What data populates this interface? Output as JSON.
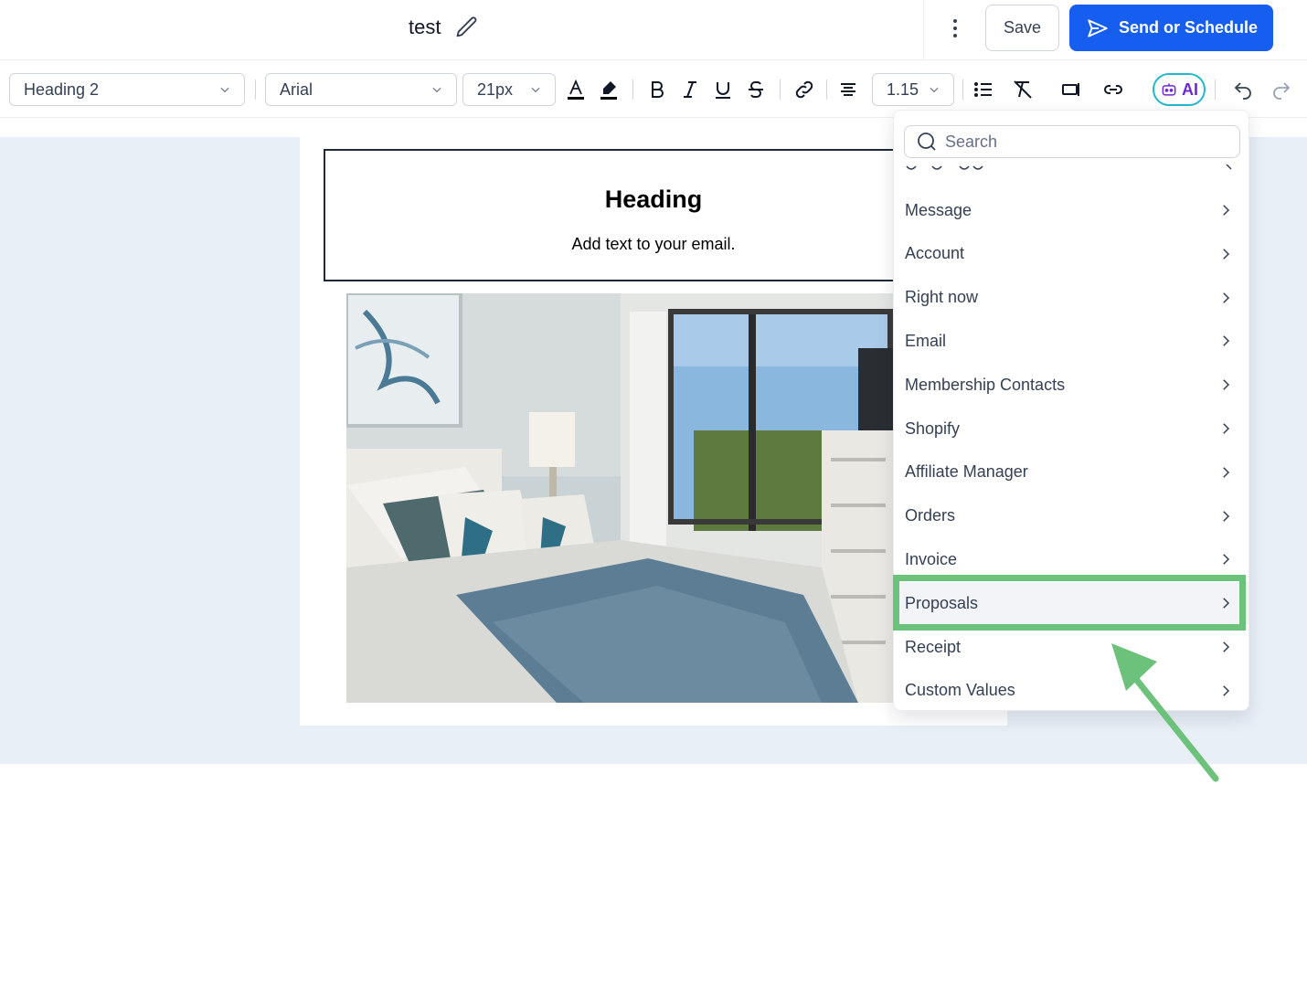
{
  "header": {
    "doc_title": "test",
    "save_label": "Save",
    "send_label": "Send or Schedule"
  },
  "toolbar": {
    "block_type": "Heading 2",
    "font_family": "Arial",
    "font_size": "21px",
    "line_height": "1.15",
    "ai_label": "AI"
  },
  "email": {
    "heading": "Heading",
    "subtext": "Add text to your email."
  },
  "dropdown": {
    "search_placeholder": "Search",
    "items": [
      {
        "label": "Message"
      },
      {
        "label": "Account"
      },
      {
        "label": "Right now"
      },
      {
        "label": "Email"
      },
      {
        "label": "Membership Contacts"
      },
      {
        "label": "Shopify"
      },
      {
        "label": "Affiliate Manager"
      },
      {
        "label": "Orders"
      },
      {
        "label": "Invoice"
      },
      {
        "label": "Proposals"
      },
      {
        "label": "Receipt"
      },
      {
        "label": "Custom Values"
      }
    ],
    "highlighted_item": "Proposals"
  },
  "colors": {
    "primary": "#155eef",
    "highlight_annotation": "#6cc27a",
    "canvas_bg": "#e9eff7"
  }
}
